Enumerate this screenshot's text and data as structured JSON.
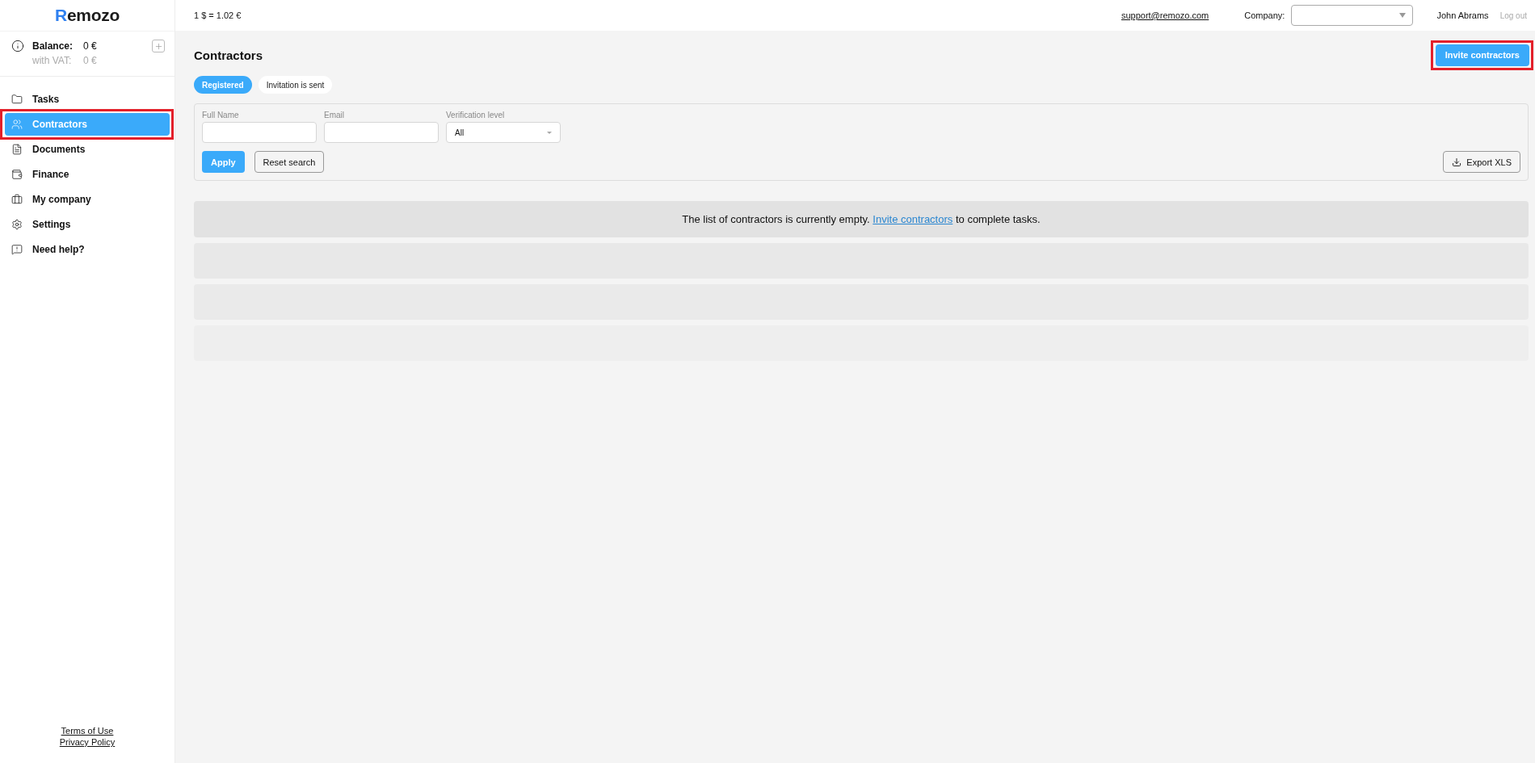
{
  "logo": "Remozo",
  "exchange_rate": "1 $ = 1.02 €",
  "header": {
    "support_email": "support@remozo.com",
    "company_label": "Company:",
    "user_name": "John Abrams",
    "logout": "Log out"
  },
  "balance": {
    "label": "Balance:",
    "value": "0 €",
    "vat_label": "with VAT:",
    "vat_value": "0 €"
  },
  "sidebar": {
    "items": [
      {
        "label": "Tasks",
        "selected": false,
        "highlighted": false
      },
      {
        "label": "Contractors",
        "selected": true,
        "highlighted": true
      },
      {
        "label": "Documents",
        "selected": false,
        "highlighted": false
      },
      {
        "label": "Finance",
        "selected": false,
        "highlighted": false
      },
      {
        "label": "My company",
        "selected": false,
        "highlighted": false
      },
      {
        "label": "Settings",
        "selected": false,
        "highlighted": false
      },
      {
        "label": "Need help?",
        "selected": false,
        "highlighted": false
      }
    ]
  },
  "footer_links": [
    "Terms of Use",
    "Privacy Policy"
  ],
  "page_title": "Contractors",
  "invite_button": {
    "label": "Invite contractors",
    "highlighted": true
  },
  "tabs": [
    {
      "label": "Registered",
      "selected": true
    },
    {
      "label": "Invitation is sent",
      "selected": false
    }
  ],
  "filters": {
    "fields": [
      {
        "label": "Full Name",
        "kind": "text"
      },
      {
        "label": "Email",
        "kind": "text"
      },
      {
        "label": "Verification level",
        "kind": "select",
        "value": "All"
      }
    ],
    "apply": "Apply",
    "reset": "Reset search",
    "export": "Export XLS"
  },
  "empty_message": {
    "before": "The list of contractors is currently empty.",
    "link": "Invite contractors",
    "after": "to complete tasks."
  }
}
